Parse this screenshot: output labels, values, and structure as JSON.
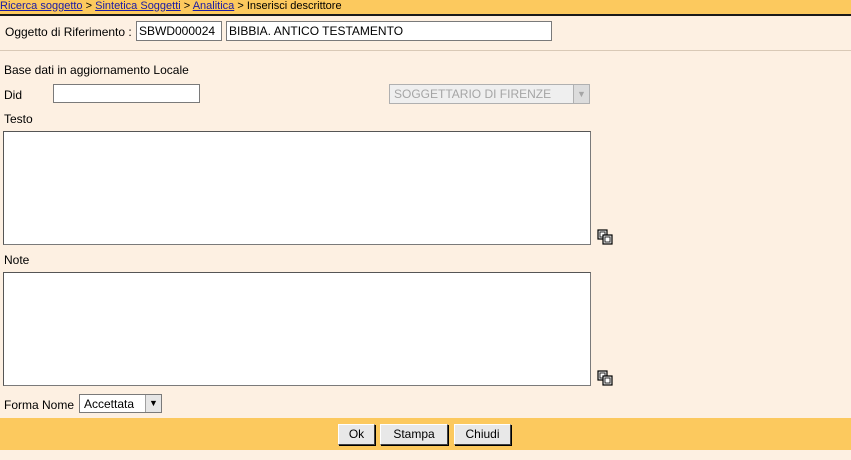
{
  "breadcrumb": {
    "items": [
      "Ricerca soggetto",
      "Sintetica Soggetti",
      "Analitica"
    ],
    "current": "Inserisci descrittore",
    "separator": ">"
  },
  "reference": {
    "label": "Oggetto di Riferimento :",
    "code": "SBWD000024",
    "title": "BIBBIA. ANTICO TESTAMENTO"
  },
  "form": {
    "base_label": "Base dati in aggiornamento Locale",
    "did_label": "Did",
    "did_value": "",
    "thesaurus_value": "SOGGETTARIO DI FIRENZE",
    "testo_label": "Testo",
    "testo_value": "",
    "note_label": "Note",
    "note_value": "",
    "forma_label": "Forma Nome",
    "forma_value": "Accettata"
  },
  "buttons": {
    "ok": "Ok",
    "stampa": "Stampa",
    "chiudi": "Chiudi"
  },
  "icons": {
    "testo_copy": "copy-icon",
    "note_copy": "copy-icon",
    "dropdown": "chevron-down-icon"
  },
  "colors": {
    "header_bar": "#fcc95e",
    "page_background": "#fdf0e2",
    "link": "#1a1aa6"
  }
}
